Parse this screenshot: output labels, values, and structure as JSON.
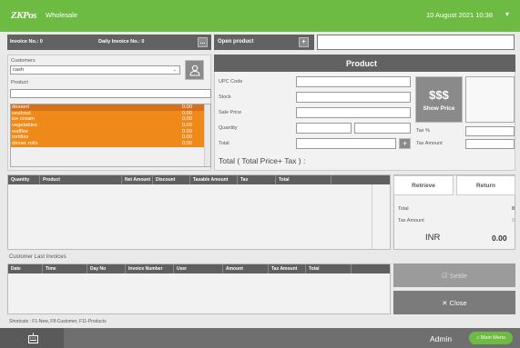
{
  "topbar": {
    "logo": "ZKPos",
    "mode": "Wholesale",
    "datetime": "10 August 2021 10:38",
    "caret": "▾"
  },
  "invoice": {
    "invoice_no_label": "Invoice No.: 0",
    "daily_invoice_label": "Daily Invoice No.: 0",
    "more_button": "..."
  },
  "open_product": {
    "label": "Open product",
    "add_button": "+",
    "input_value": ""
  },
  "customers": {
    "label": "Customers",
    "selected": "cash",
    "product_label": "Product",
    "product_value": ""
  },
  "product_list": [
    {
      "name": "dessert",
      "value": "0.00",
      "selected": true
    },
    {
      "name": "seafood",
      "value": "0.00"
    },
    {
      "name": "ice cream",
      "value": "0.00"
    },
    {
      "name": "vegetables",
      "value": "0.00"
    },
    {
      "name": "waffles",
      "value": "0.00"
    },
    {
      "name": "tortillas",
      "value": "0.00"
    },
    {
      "name": "dinner rolls",
      "value": "0.00"
    }
  ],
  "product_panel": {
    "title": "Product",
    "upc_label": "UPC Code",
    "stock_label": "Stock",
    "sale_price_label": "Sale Price",
    "quantity_label": "Quantity",
    "total_label": "Total",
    "tax_pct_label": "Tax %",
    "tax_amount_label": "Tax Amount",
    "show_price_icon": "$$$",
    "show_price_label": "Show Price",
    "add_button": "+",
    "total_formula": "Total ( Total Price+ Tax ) :"
  },
  "cart_table": {
    "headers": [
      "Quantity",
      "Product",
      "Net Amount",
      "Discount",
      "Taxable Amount",
      "Tax",
      "Total"
    ]
  },
  "actions": {
    "retrieve": "Retrieve",
    "return": "Return"
  },
  "summary": {
    "total_label": "Total",
    "total_value": "0",
    "tax_label": "Tax Amount",
    "tax_value": "0",
    "currency": "INR",
    "grand_total": "0.00"
  },
  "last_invoices": {
    "title": "Customer Last Invoices",
    "headers": [
      "Date",
      "Time",
      "Day No",
      "Invoice Number",
      "User",
      "Amount",
      "Tax Amount",
      "Total"
    ]
  },
  "settle": {
    "label": "Settle",
    "icon": "☑"
  },
  "close": {
    "label": "Close",
    "icon": "✕"
  },
  "shortcuts": "Shortcuts : F1-New, F8-Customer, F11-Products",
  "bottombar": {
    "user": "Admin",
    "main_menu": "Main Menu"
  }
}
